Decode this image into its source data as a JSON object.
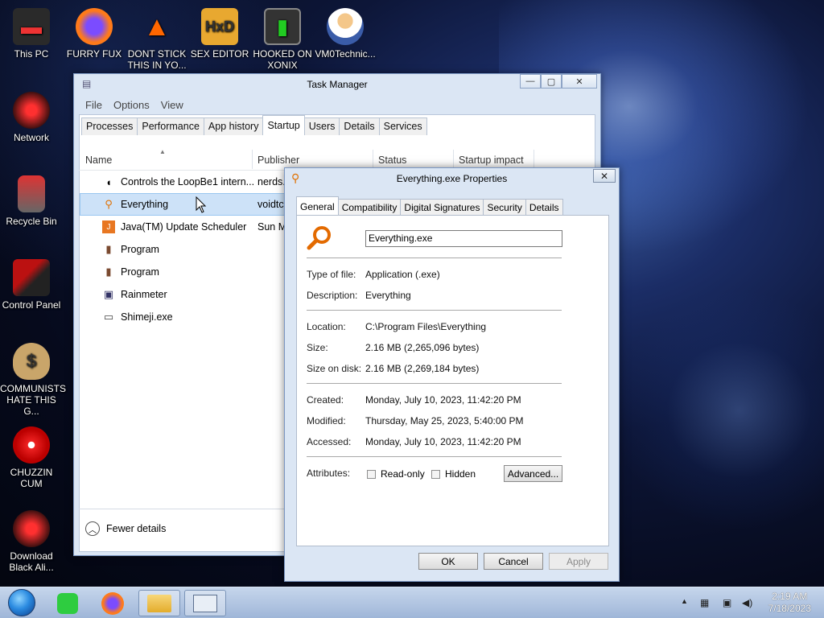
{
  "desktop": {
    "icons": [
      {
        "label": "This PC"
      },
      {
        "label": "FURRY FUX"
      },
      {
        "label": "DONT STICK THIS IN YO..."
      },
      {
        "label": "SEX EDITOR"
      },
      {
        "label": "HOOKED ON XONIX"
      },
      {
        "label": "VM0Technic..."
      },
      {
        "label": "Network"
      },
      {
        "label": "Recycle Bin"
      },
      {
        "label": "Control Panel"
      },
      {
        "label": "COMMUNISTS HATE THIS G..."
      },
      {
        "label": "CHUZZIN CUM"
      },
      {
        "label": "Download Black Ali..."
      }
    ]
  },
  "task_manager": {
    "title": "Task Manager",
    "menu": [
      "File",
      "Options",
      "View"
    ],
    "tabs": [
      "Processes",
      "Performance",
      "App history",
      "Startup",
      "Users",
      "Details",
      "Services"
    ],
    "active_tab": "Startup",
    "columns": [
      "Name",
      "Publisher",
      "Status",
      "Startup impact"
    ],
    "rows": [
      {
        "name": "Controls the LoopBe1 intern...",
        "publisher": "nerds."
      },
      {
        "name": "Everything",
        "publisher": "voidtc"
      },
      {
        "name": "Java(TM) Update Scheduler",
        "publisher": "Sun M"
      },
      {
        "name": "Program",
        "publisher": ""
      },
      {
        "name": "Program",
        "publisher": ""
      },
      {
        "name": "Rainmeter",
        "publisher": ""
      },
      {
        "name": "Shimeji.exe",
        "publisher": ""
      }
    ],
    "fewer_details": "Fewer details"
  },
  "properties": {
    "title": "Everything.exe Properties",
    "tabs": [
      "General",
      "Compatibility",
      "Digital Signatures",
      "Security",
      "Details"
    ],
    "active_tab": "General",
    "filename": "Everything.exe",
    "type_label": "Type of file:",
    "type_value": "Application (.exe)",
    "desc_label": "Description:",
    "desc_value": "Everything",
    "location_label": "Location:",
    "location_value": "C:\\Program Files\\Everything",
    "size_label": "Size:",
    "size_value": "2.16 MB (2,265,096 bytes)",
    "sizedisk_label": "Size on disk:",
    "sizedisk_value": "2.16 MB (2,269,184 bytes)",
    "created_label": "Created:",
    "created_value": "Monday, July 10, 2023, 11:42:20 PM",
    "modified_label": "Modified:",
    "modified_value": "Thursday, May 25, 2023, 5:40:00 PM",
    "accessed_label": "Accessed:",
    "accessed_value": "Monday, July 10, 2023, 11:42:20 PM",
    "attributes_label": "Attributes:",
    "readonly_label": "Read-only",
    "hidden_label": "Hidden",
    "advanced_label": "Advanced...",
    "ok_label": "OK",
    "cancel_label": "Cancel",
    "apply_label": "Apply"
  },
  "taskbar": {
    "time": "2:19 AM",
    "date": "7/18/2023"
  },
  "colors": {
    "accent": "#cde2f8",
    "title_bar": "#dbe6f4",
    "taskbar": "#b4c8e4"
  }
}
